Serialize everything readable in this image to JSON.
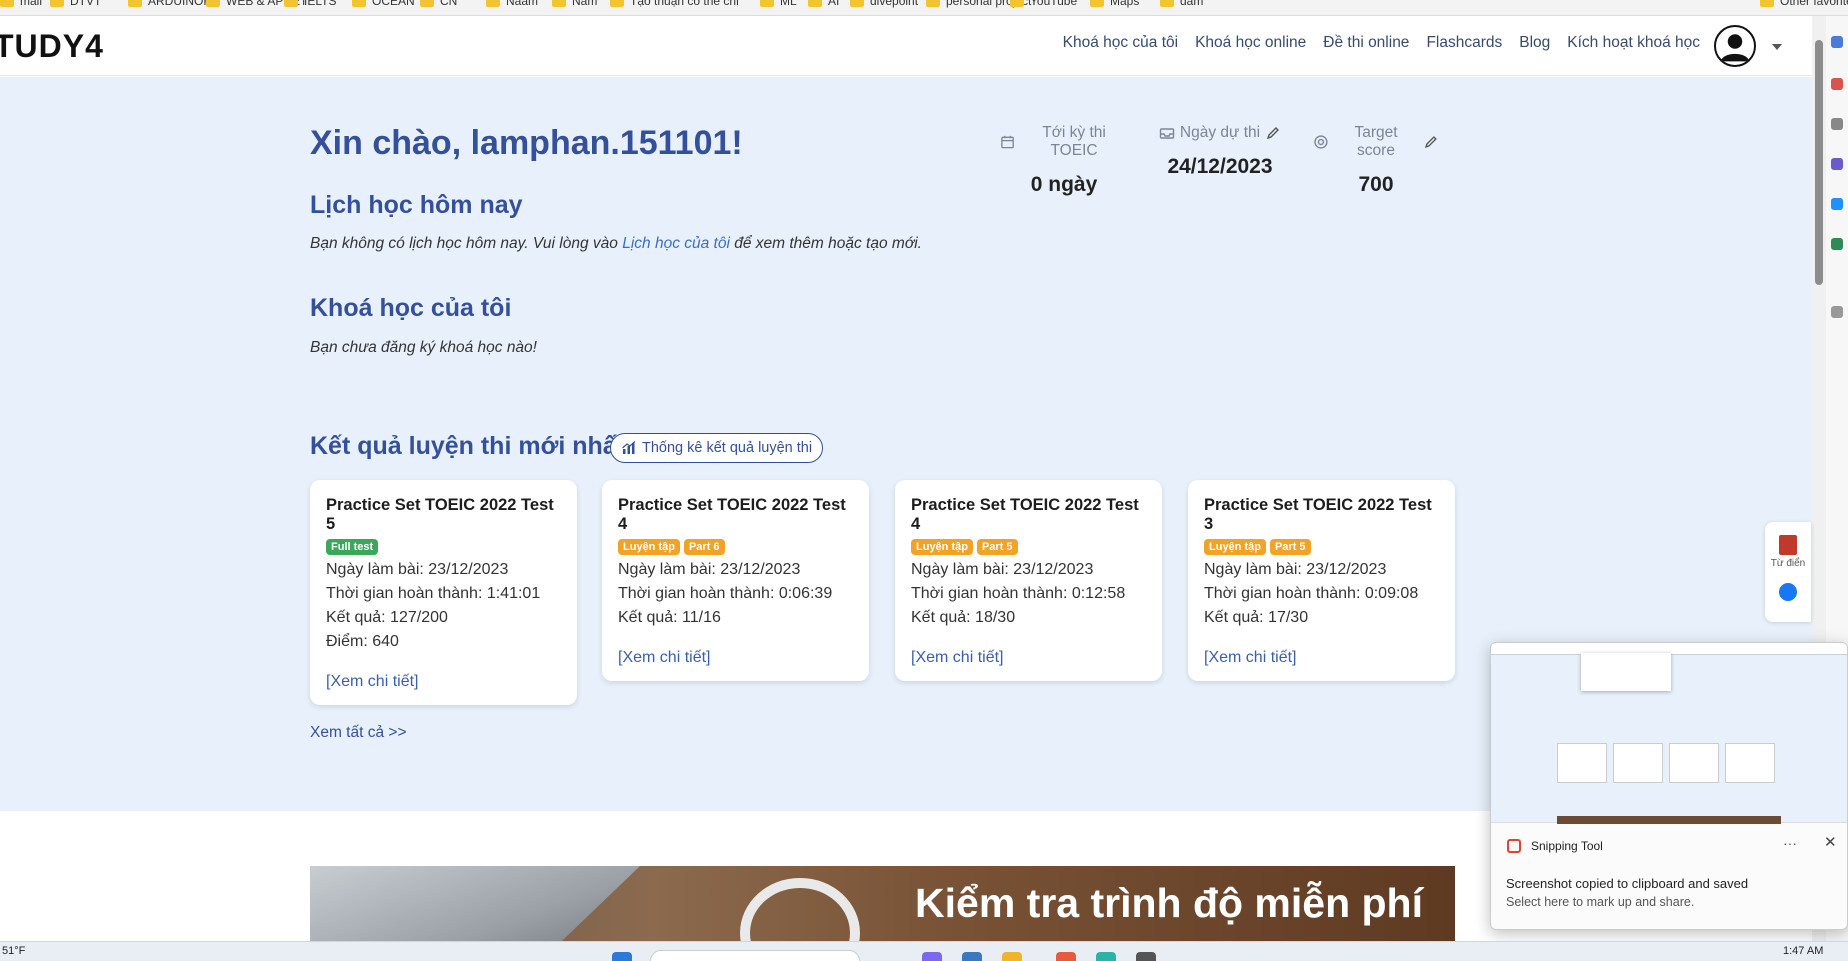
{
  "bookmarks": [
    "mail",
    "DTVT",
    "ARDUINOR",
    "WEB & APNET",
    "IELTS",
    "OCEAN",
    "CN",
    "Naam",
    "Nam",
    "Tạo thuận có thể chi",
    "ML",
    "AI",
    "divepoint",
    "personal project",
    "YouTube",
    "Maps",
    "đâm",
    "Other favorites"
  ],
  "header": {
    "logo": "TUDY4",
    "nav": [
      "Khoá học của tôi",
      "Khoá học online",
      "Đề thi online",
      "Flashcards",
      "Blog",
      "Kích hoạt khoá học"
    ]
  },
  "dashboard": {
    "greeting": "Xin chào, lamphan.151101!",
    "stats": [
      {
        "label": "Tới kỳ thi TOEIC",
        "value": "0 ngày",
        "icon": "calendar-icon"
      },
      {
        "label": "Ngày dự thi",
        "value": "24/12/2023",
        "icon": "inbox-icon"
      },
      {
        "label": "Target score",
        "value": "700",
        "icon": "target-icon"
      }
    ],
    "schedule_title": "Lịch học hôm nay",
    "schedule_note_pre": "Bạn không có lịch học hôm nay. Vui lòng vào ",
    "schedule_note_link": "Lịch học của tôi",
    "schedule_note_post": " để xem thêm hoặc tạo mới.",
    "courses_title": "Khoá học của tôi",
    "courses_note": "Bạn chưa đăng ký khoá học nào!",
    "results_title": "Kết quả luyện thi mới nhất",
    "results_button": "Thống kê kết quả luyện thi",
    "see_all": "Xem tất cả >>"
  },
  "cards": [
    {
      "title": "Practice Set TOEIC 2022 Test 5",
      "badges": [
        {
          "text": "Full test",
          "color": "green"
        }
      ],
      "lines": [
        "Ngày làm bài: 23/12/2023",
        "Thời gian hoàn thành: 1:41:01",
        "Kết quả: 127/200",
        "Điểm: 640"
      ],
      "link": "[Xem chi tiết]"
    },
    {
      "title": "Practice Set TOEIC 2022 Test 4",
      "badges": [
        {
          "text": "Luyện tập",
          "color": "orange"
        },
        {
          "text": "Part 6",
          "color": "orange"
        }
      ],
      "lines": [
        "Ngày làm bài: 23/12/2023",
        "Thời gian hoàn thành: 0:06:39",
        "Kết quả: 11/16"
      ],
      "link": "[Xem chi tiết]"
    },
    {
      "title": "Practice Set TOEIC 2022 Test 4",
      "badges": [
        {
          "text": "Luyện tập",
          "color": "orange"
        },
        {
          "text": "Part 5",
          "color": "orange"
        }
      ],
      "lines": [
        "Ngày làm bài: 23/12/2023",
        "Thời gian hoàn thành: 0:12:58",
        "Kết quả: 18/30"
      ],
      "link": "[Xem chi tiết]"
    },
    {
      "title": "Practice Set TOEIC 2022 Test 3",
      "badges": [
        {
          "text": "Luyện tập",
          "color": "orange"
        },
        {
          "text": "Part 5",
          "color": "orange"
        }
      ],
      "lines": [
        "Ngày làm bài: 23/12/2023",
        "Thời gian hoàn thành: 0:09:08",
        "Kết quả: 17/30"
      ],
      "link": "[Xem chi tiết]"
    }
  ],
  "banner": {
    "text": "Kiểm tra trình độ miễn phí"
  },
  "dict_widget": {
    "label": "Từ điển"
  },
  "snipping": {
    "title": "Snipping Tool",
    "more": "···",
    "close": "✕",
    "message": "Screenshot copied to clipboard and saved",
    "sub": "Select here to mark up and share."
  },
  "taskbar": {
    "weather": "51°F",
    "time": "1:47 AM"
  },
  "colors": {
    "primary": "#35509a",
    "page_bg": "#e8f1fb",
    "green_badge": "#3aa85a",
    "orange_badge": "#f2a325"
  }
}
